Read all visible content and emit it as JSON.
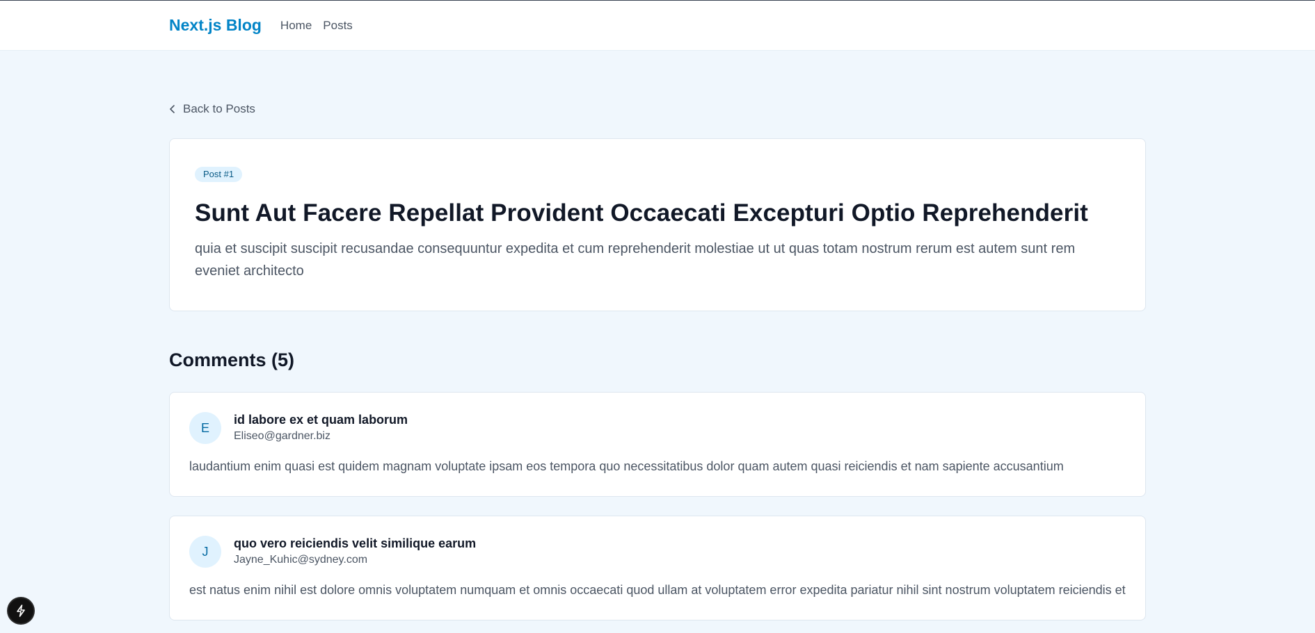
{
  "header": {
    "brand": "Next.js Blog",
    "nav": [
      {
        "label": "Home"
      },
      {
        "label": "Posts"
      }
    ]
  },
  "back_link": {
    "label": "Back to Posts"
  },
  "post": {
    "badge": "Post #1",
    "title": "Sunt Aut Facere Repellat Provident Occaecati Excepturi Optio Reprehenderit",
    "body": "quia et suscipit suscipit recusandae consequuntur expedita et cum reprehenderit molestiae ut ut quas totam nostrum rerum est autem sunt rem eveniet architecto"
  },
  "comments": {
    "heading": "Comments (5)",
    "items": [
      {
        "initial": "E",
        "name": "id labore ex et quam laborum",
        "email": "Eliseo@gardner.biz",
        "body": "laudantium enim quasi est quidem magnam voluptate ipsam eos tempora quo necessitatibus dolor quam autem quasi reiciendis et nam sapiente accusantium"
      },
      {
        "initial": "J",
        "name": "quo vero reiciendis velit similique earum",
        "email": "Jayne_Kuhic@sydney.com",
        "body": "est natus enim nihil est dolore omnis voluptatem numquam et omnis occaecati quod ullam at voluptatem error expedita pariatur nihil sint nostrum voluptatem reiciendis et"
      }
    ]
  },
  "icons": {
    "back": "chevron-left-icon",
    "dev_indicator": "lightning-bolt-icon"
  },
  "colors": {
    "brand": "#0284c7",
    "page_background": "#f0f7fd",
    "badge_background": "#e0f2fe",
    "avatar_text": "#0369a1"
  }
}
